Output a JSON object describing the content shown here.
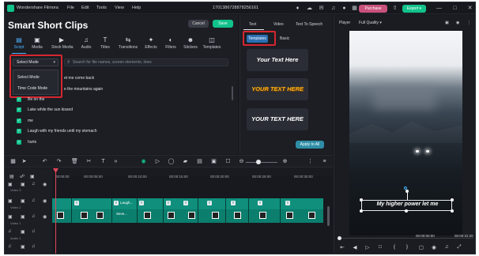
{
  "titlebar": {
    "app_name": "Wondershare Filmora",
    "menu": [
      "File",
      "Edit",
      "Tools",
      "View",
      "Help"
    ],
    "project_id": "1701386728878256161",
    "purchase_label": "Purchase",
    "export_label": "Export"
  },
  "smart_clips": {
    "title": "Smart Short Clips",
    "cancel_label": "Cancel",
    "save_label": "Save",
    "tools": [
      {
        "label": "Script",
        "icon": "script-icon"
      },
      {
        "label": "Media",
        "icon": "media-icon"
      },
      {
        "label": "Stock Media",
        "icon": "stock-media-icon"
      },
      {
        "label": "Audio",
        "icon": "audio-icon"
      },
      {
        "label": "Titles",
        "icon": "titles-icon"
      },
      {
        "label": "Transitions",
        "icon": "transitions-icon"
      },
      {
        "label": "Effects",
        "icon": "effects-icon"
      },
      {
        "label": "Filters",
        "icon": "filters-icon"
      },
      {
        "label": "Stickers",
        "icon": "stickers-icon"
      },
      {
        "label": "Templates",
        "icon": "templates-icon"
      }
    ],
    "mode_select_value": "Select Mode",
    "search_placeholder": "Search for file names, screen elements, lines",
    "mode_options": [
      "Select Mode",
      "Time Code Mode"
    ],
    "partial_lines": [
      "et me come back",
      "e the mountains again"
    ],
    "lines": [
      "Be on the",
      "Lake while the sun kissed",
      "me",
      "Laugh with my friends until my stomach",
      "hurts"
    ]
  },
  "text_panel": {
    "tabs": [
      "Text",
      "Video",
      "Text To Speech"
    ],
    "sub_tabs": [
      "Templates",
      "Basic"
    ],
    "templates": [
      "Your Text Here",
      "YOUR TEXT HERE",
      "YOUR TEXT HERE"
    ],
    "apply_label": "Apply to All"
  },
  "player": {
    "label": "Player",
    "quality": "Full Quality",
    "caption": "My higher power let me",
    "current_time": "00:00:00:00",
    "total_time": "00:00:31:20"
  },
  "timeline": {
    "ruler": [
      "00:00:00",
      "00:00:05:00",
      "00:00:10:00",
      "00:00:15:00",
      "00:00:20:00",
      "00:00:25:00",
      "00:00:30:00"
    ],
    "track_labels": [
      "Video 3",
      "Video 2",
      "Video 1",
      "Audio 1"
    ],
    "clips": [
      {
        "badge": "T",
        "title": ""
      },
      {
        "badge": "T",
        "title": "Laugh..."
      },
      {
        "badge": "T",
        "title": ""
      },
      {
        "badge": "T",
        "title": ""
      },
      {
        "badge": "T",
        "title": ""
      },
      {
        "badge": "T",
        "title": ""
      },
      {
        "badge": "T",
        "title": ""
      },
      {
        "badge": "T",
        "title": ""
      },
      {
        "badge": "T",
        "title": ""
      }
    ],
    "clip_sub": [
      "Seve..."
    ]
  }
}
